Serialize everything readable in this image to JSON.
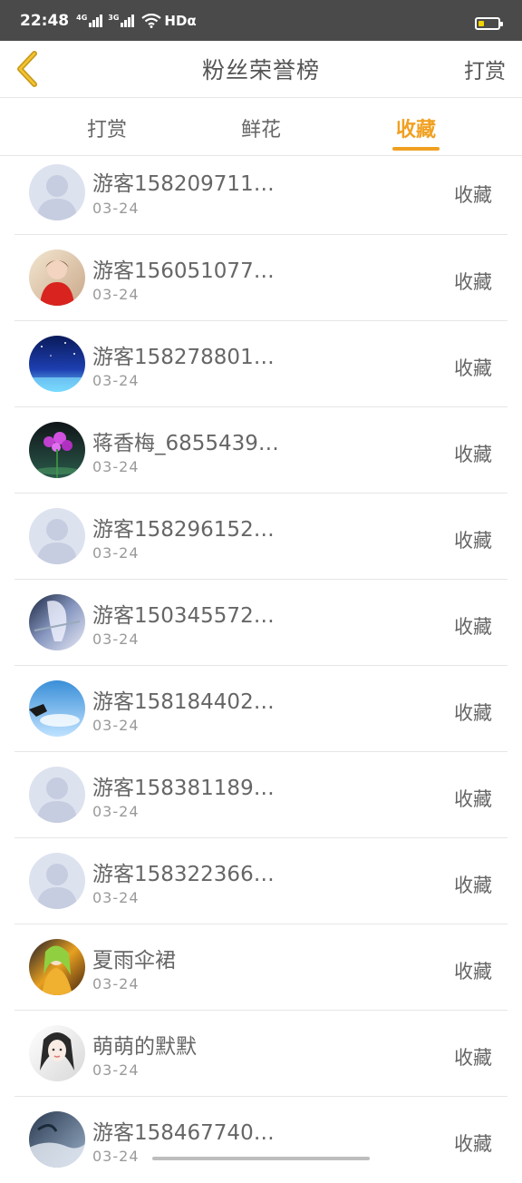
{
  "status_bar": {
    "time": "22:48",
    "net1": "4G",
    "net2": "3G",
    "wifi_label": "HDα"
  },
  "header": {
    "title": "粉丝荣誉榜",
    "right_action": "打赏"
  },
  "tabs": [
    {
      "label": "打赏",
      "active": false
    },
    {
      "label": "鲜花",
      "active": false
    },
    {
      "label": "收藏",
      "active": true
    }
  ],
  "colors": {
    "accent": "#f0a020"
  },
  "fans": [
    {
      "name": "游客158209711…",
      "date": "03-24",
      "action": "收藏",
      "avatar": "default-avatar"
    },
    {
      "name": "游客156051077…",
      "date": "03-24",
      "action": "收藏",
      "avatar": "photo-avatar"
    },
    {
      "name": "游客158278801…",
      "date": "03-24",
      "action": "收藏",
      "avatar": "photo-avatar"
    },
    {
      "name": "蒋香梅_6855439…",
      "date": "03-24",
      "action": "收藏",
      "avatar": "photo-avatar"
    },
    {
      "name": "游客158296152…",
      "date": "03-24",
      "action": "收藏",
      "avatar": "default-avatar"
    },
    {
      "name": "游客150345572…",
      "date": "03-24",
      "action": "收藏",
      "avatar": "photo-avatar"
    },
    {
      "name": "游客158184402…",
      "date": "03-24",
      "action": "收藏",
      "avatar": "photo-avatar"
    },
    {
      "name": "游客158381189…",
      "date": "03-24",
      "action": "收藏",
      "avatar": "default-avatar"
    },
    {
      "name": "游客158322366…",
      "date": "03-24",
      "action": "收藏",
      "avatar": "default-avatar"
    },
    {
      "name": "夏雨伞裙",
      "date": "03-24",
      "action": "收藏",
      "avatar": "photo-avatar"
    },
    {
      "name": "萌萌的默默",
      "date": "03-24",
      "action": "收藏",
      "avatar": "photo-avatar"
    },
    {
      "name": "游客158467740…",
      "date": "03-24",
      "action": "收藏",
      "avatar": "photo-avatar"
    }
  ]
}
